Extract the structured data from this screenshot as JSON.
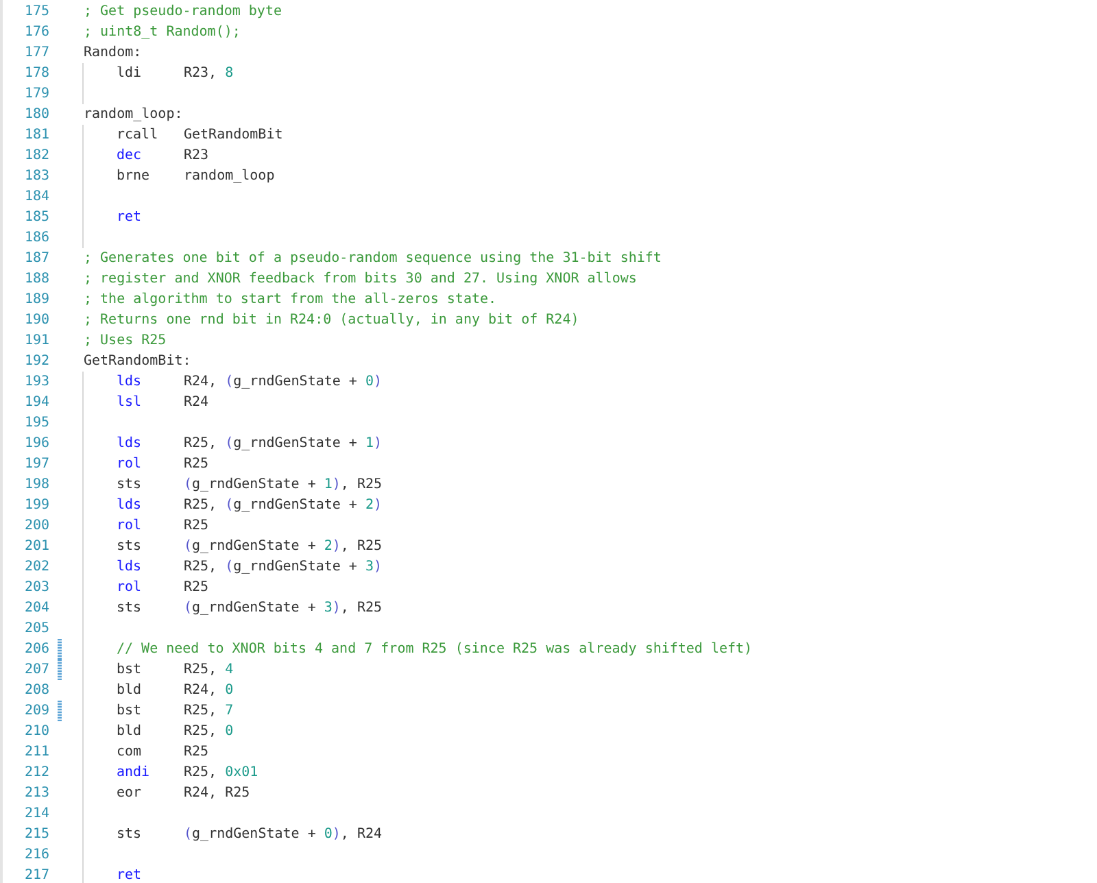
{
  "editor": {
    "lines": [
      {
        "number": "175",
        "kind": "comment",
        "text": "; Get pseudo-random byte",
        "in_block": false,
        "modified": false
      },
      {
        "number": "176",
        "kind": "comment",
        "text": "; uint8_t Random();",
        "in_block": false,
        "modified": false
      },
      {
        "number": "177",
        "kind": "label",
        "text": "Random:",
        "in_block": false,
        "modified": false
      },
      {
        "number": "178",
        "kind": "instruction",
        "op": {
          "text": "ldi",
          "keyword": false
        },
        "args": [
          {
            "text": "R23, ",
            "kind": "plain"
          },
          {
            "text": "8",
            "kind": "number"
          }
        ],
        "in_block": true,
        "modified": false
      },
      {
        "number": "179",
        "kind": "blank",
        "in_block": true,
        "modified": false
      },
      {
        "number": "180",
        "kind": "label",
        "text": "random_loop:",
        "in_block": false,
        "modified": false
      },
      {
        "number": "181",
        "kind": "instruction",
        "op": {
          "text": "rcall",
          "keyword": false
        },
        "args": [
          {
            "text": "GetRandomBit",
            "kind": "plain"
          }
        ],
        "in_block": true,
        "modified": false
      },
      {
        "number": "182",
        "kind": "instruction",
        "op": {
          "text": "dec",
          "keyword": true
        },
        "args": [
          {
            "text": "R23",
            "kind": "plain"
          }
        ],
        "in_block": true,
        "modified": false
      },
      {
        "number": "183",
        "kind": "instruction",
        "op": {
          "text": "brne",
          "keyword": false
        },
        "args": [
          {
            "text": "random_loop",
            "kind": "plain"
          }
        ],
        "in_block": true,
        "modified": false
      },
      {
        "number": "184",
        "kind": "blank",
        "in_block": true,
        "modified": false
      },
      {
        "number": "185",
        "kind": "instruction",
        "op": {
          "text": "ret",
          "keyword": true
        },
        "in_block": true,
        "modified": false
      },
      {
        "number": "186",
        "kind": "blank",
        "in_block": true,
        "modified": false
      },
      {
        "number": "187",
        "kind": "comment",
        "text": "; Generates one bit of a pseudo-random sequence using the 31-bit shift",
        "in_block": false,
        "modified": false
      },
      {
        "number": "188",
        "kind": "comment",
        "text": "; register and XNOR feedback from bits 30 and 27. Using XNOR allows",
        "in_block": false,
        "modified": false
      },
      {
        "number": "189",
        "kind": "comment",
        "text": "; the algorithm to start from the all-zeros state.",
        "in_block": false,
        "modified": false
      },
      {
        "number": "190",
        "kind": "comment",
        "text": "; Returns one rnd bit in R24:0 (actually, in any bit of R24)",
        "in_block": false,
        "modified": false
      },
      {
        "number": "191",
        "kind": "comment",
        "text": "; Uses R25",
        "in_block": false,
        "modified": false
      },
      {
        "number": "192",
        "kind": "label",
        "text": "GetRandomBit:",
        "in_block": false,
        "modified": false
      },
      {
        "number": "193",
        "kind": "instruction",
        "op": {
          "text": "lds",
          "keyword": true
        },
        "args": [
          {
            "text": "R24, ",
            "kind": "plain"
          },
          {
            "text": "(",
            "kind": "paren"
          },
          {
            "text": "g_rndGenState + ",
            "kind": "plain"
          },
          {
            "text": "0",
            "kind": "number"
          },
          {
            "text": ")",
            "kind": "paren"
          }
        ],
        "in_block": true,
        "modified": false
      },
      {
        "number": "194",
        "kind": "instruction",
        "op": {
          "text": "lsl",
          "keyword": true
        },
        "args": [
          {
            "text": "R24",
            "kind": "plain"
          }
        ],
        "in_block": true,
        "modified": false
      },
      {
        "number": "195",
        "kind": "blank",
        "in_block": true,
        "modified": false
      },
      {
        "number": "196",
        "kind": "instruction",
        "op": {
          "text": "lds",
          "keyword": true
        },
        "args": [
          {
            "text": "R25, ",
            "kind": "plain"
          },
          {
            "text": "(",
            "kind": "paren"
          },
          {
            "text": "g_rndGenState + ",
            "kind": "plain"
          },
          {
            "text": "1",
            "kind": "number"
          },
          {
            "text": ")",
            "kind": "paren"
          }
        ],
        "in_block": true,
        "modified": false
      },
      {
        "number": "197",
        "kind": "instruction",
        "op": {
          "text": "rol",
          "keyword": true
        },
        "args": [
          {
            "text": "R25",
            "kind": "plain"
          }
        ],
        "in_block": true,
        "modified": false
      },
      {
        "number": "198",
        "kind": "instruction",
        "op": {
          "text": "sts",
          "keyword": false
        },
        "args": [
          {
            "text": "(",
            "kind": "paren"
          },
          {
            "text": "g_rndGenState + ",
            "kind": "plain"
          },
          {
            "text": "1",
            "kind": "number"
          },
          {
            "text": ")",
            "kind": "paren"
          },
          {
            "text": ", R25",
            "kind": "plain"
          }
        ],
        "in_block": true,
        "modified": false
      },
      {
        "number": "199",
        "kind": "instruction",
        "op": {
          "text": "lds",
          "keyword": true
        },
        "args": [
          {
            "text": "R25, ",
            "kind": "plain"
          },
          {
            "text": "(",
            "kind": "paren"
          },
          {
            "text": "g_rndGenState + ",
            "kind": "plain"
          },
          {
            "text": "2",
            "kind": "number"
          },
          {
            "text": ")",
            "kind": "paren"
          }
        ],
        "in_block": true,
        "modified": false
      },
      {
        "number": "200",
        "kind": "instruction",
        "op": {
          "text": "rol",
          "keyword": true
        },
        "args": [
          {
            "text": "R25",
            "kind": "plain"
          }
        ],
        "in_block": true,
        "modified": false
      },
      {
        "number": "201",
        "kind": "instruction",
        "op": {
          "text": "sts",
          "keyword": false
        },
        "args": [
          {
            "text": "(",
            "kind": "paren"
          },
          {
            "text": "g_rndGenState + ",
            "kind": "plain"
          },
          {
            "text": "2",
            "kind": "number"
          },
          {
            "text": ")",
            "kind": "paren"
          },
          {
            "text": ", R25",
            "kind": "plain"
          }
        ],
        "in_block": true,
        "modified": false
      },
      {
        "number": "202",
        "kind": "instruction",
        "op": {
          "text": "lds",
          "keyword": true
        },
        "args": [
          {
            "text": "R25, ",
            "kind": "plain"
          },
          {
            "text": "(",
            "kind": "paren"
          },
          {
            "text": "g_rndGenState + ",
            "kind": "plain"
          },
          {
            "text": "3",
            "kind": "number"
          },
          {
            "text": ")",
            "kind": "paren"
          }
        ],
        "in_block": true,
        "modified": false
      },
      {
        "number": "203",
        "kind": "instruction",
        "op": {
          "text": "rol",
          "keyword": true
        },
        "args": [
          {
            "text": "R25",
            "kind": "plain"
          }
        ],
        "in_block": true,
        "modified": false
      },
      {
        "number": "204",
        "kind": "instruction",
        "op": {
          "text": "sts",
          "keyword": false
        },
        "args": [
          {
            "text": "(",
            "kind": "paren"
          },
          {
            "text": "g_rndGenState + ",
            "kind": "plain"
          },
          {
            "text": "3",
            "kind": "number"
          },
          {
            "text": ")",
            "kind": "paren"
          },
          {
            "text": ", R25",
            "kind": "plain"
          }
        ],
        "in_block": true,
        "modified": false
      },
      {
        "number": "205",
        "kind": "blank",
        "in_block": true,
        "modified": false
      },
      {
        "number": "206",
        "kind": "inner_comment",
        "text": "// We need to XNOR bits 4 and 7 from R25 (since R25 was already shifted left)",
        "in_block": true,
        "modified": true
      },
      {
        "number": "207",
        "kind": "instruction",
        "op": {
          "text": "bst",
          "keyword": false
        },
        "args": [
          {
            "text": "R25, ",
            "kind": "plain"
          },
          {
            "text": "4",
            "kind": "number"
          }
        ],
        "in_block": true,
        "modified": true
      },
      {
        "number": "208",
        "kind": "instruction",
        "op": {
          "text": "bld",
          "keyword": false
        },
        "args": [
          {
            "text": "R24, ",
            "kind": "plain"
          },
          {
            "text": "0",
            "kind": "number"
          }
        ],
        "in_block": true,
        "modified": false
      },
      {
        "number": "209",
        "kind": "instruction",
        "op": {
          "text": "bst",
          "keyword": false
        },
        "args": [
          {
            "text": "R25, ",
            "kind": "plain"
          },
          {
            "text": "7",
            "kind": "number"
          }
        ],
        "in_block": true,
        "modified": true
      },
      {
        "number": "210",
        "kind": "instruction",
        "op": {
          "text": "bld",
          "keyword": false
        },
        "args": [
          {
            "text": "R25, ",
            "kind": "plain"
          },
          {
            "text": "0",
            "kind": "number"
          }
        ],
        "in_block": true,
        "modified": false
      },
      {
        "number": "211",
        "kind": "instruction",
        "op": {
          "text": "com",
          "keyword": false
        },
        "args": [
          {
            "text": "R25",
            "kind": "plain"
          }
        ],
        "in_block": true,
        "modified": false
      },
      {
        "number": "212",
        "kind": "instruction",
        "op": {
          "text": "andi",
          "keyword": true
        },
        "args": [
          {
            "text": "R25, ",
            "kind": "plain"
          },
          {
            "text": "0x01",
            "kind": "number"
          }
        ],
        "in_block": true,
        "modified": false
      },
      {
        "number": "213",
        "kind": "instruction",
        "op": {
          "text": "eor",
          "keyword": false
        },
        "args": [
          {
            "text": "R24, R25",
            "kind": "plain"
          }
        ],
        "in_block": true,
        "modified": false
      },
      {
        "number": "214",
        "kind": "blank",
        "in_block": true,
        "modified": false
      },
      {
        "number": "215",
        "kind": "instruction",
        "op": {
          "text": "sts",
          "keyword": false
        },
        "args": [
          {
            "text": "(",
            "kind": "paren"
          },
          {
            "text": "g_rndGenState + ",
            "kind": "plain"
          },
          {
            "text": "0",
            "kind": "number"
          },
          {
            "text": ")",
            "kind": "paren"
          },
          {
            "text": ", R24",
            "kind": "plain"
          }
        ],
        "in_block": true,
        "modified": false
      },
      {
        "number": "216",
        "kind": "blank",
        "in_block": true,
        "modified": false
      },
      {
        "number": "217",
        "kind": "instruction",
        "op": {
          "text": "ret",
          "keyword": true
        },
        "in_block": true,
        "modified": false
      }
    ]
  }
}
